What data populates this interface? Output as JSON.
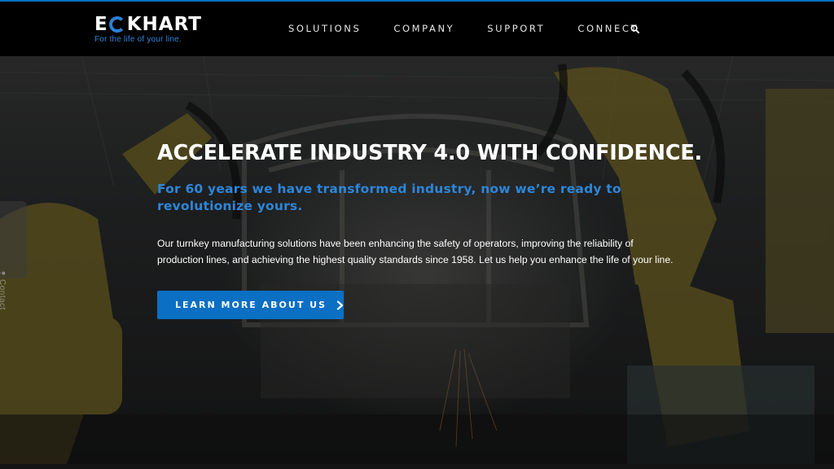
{
  "brand": {
    "name_first": "E",
    "name_rest": "KHART",
    "tagline": "For the life of your line.",
    "accent_color": "#0b6fc4"
  },
  "nav": {
    "items": [
      {
        "label": "SOLUTIONS"
      },
      {
        "label": "COMPANY"
      },
      {
        "label": "SUPPORT"
      },
      {
        "label": "CONNECT"
      }
    ],
    "search_icon": "search-icon"
  },
  "hero": {
    "headline": "ACCELERATE INDUSTRY 4.0 WITH CONFIDENCE.",
    "subheadline": "For 60 years we have transformed industry, now we’re ready to revolutionize yours.",
    "body": "Our turnkey manufacturing solutions have been enhancing the safety of operators, improving the reliability of production lines, and achieving the highest quality standards since 1958. Let us help you enhance the life of your line.",
    "cta_label": "LEARN MORE ABOUT US",
    "cta_icon": "chevron-right-icon"
  },
  "contact_tab": {
    "label": "Contact",
    "icon": "user-icon"
  }
}
